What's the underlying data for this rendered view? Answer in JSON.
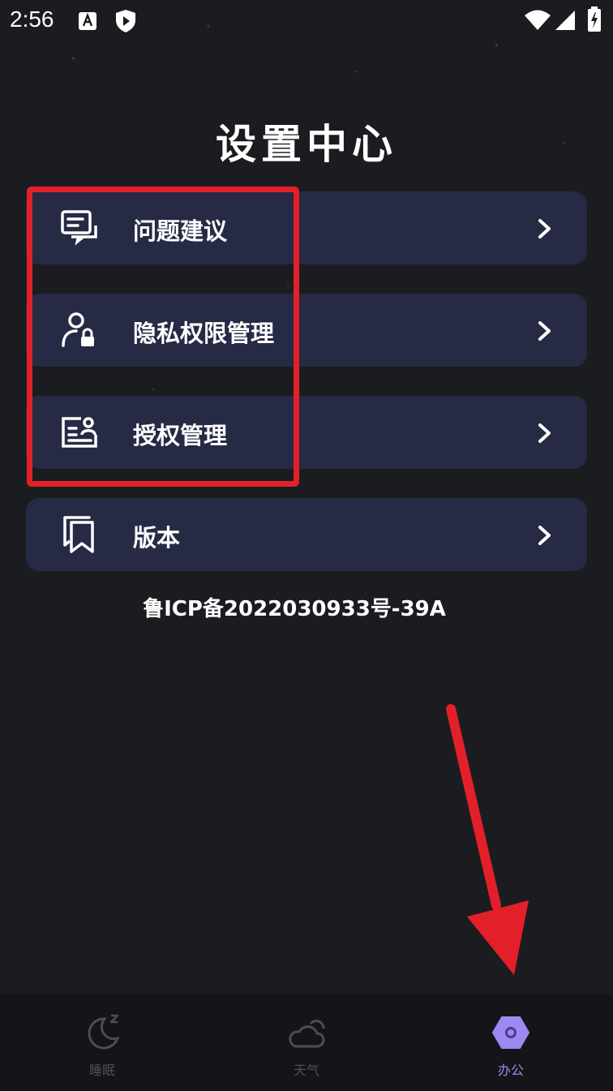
{
  "status_bar": {
    "time": "2:56",
    "icons": [
      "text-a-icon",
      "play-protect-icon",
      "wifi-icon",
      "signal-icon",
      "battery-charging-icon"
    ]
  },
  "page": {
    "title": "设置中心"
  },
  "menu": {
    "items": [
      {
        "label": "问题建议",
        "icon": "feedback-icon"
      },
      {
        "label": "隐私权限管理",
        "icon": "user-lock-icon"
      },
      {
        "label": "授权管理",
        "icon": "id-card-icon"
      },
      {
        "label": "版本",
        "icon": "book-icon"
      }
    ]
  },
  "footer": {
    "icp": "鲁ICP备2022030933号-39A"
  },
  "bottom_nav": {
    "items": [
      {
        "label": "睡眠",
        "icon": "moon-z-icon",
        "active": false
      },
      {
        "label": "天气",
        "icon": "cloud-sun-icon",
        "active": false
      },
      {
        "label": "办公",
        "icon": "hexagon-icon",
        "active": true
      }
    ]
  },
  "colors": {
    "background": "#1b1c20",
    "card": "#272a44",
    "accent": "#9e89f2",
    "annotation": "#e3202a",
    "nav_inactive": "#4c4e57"
  }
}
